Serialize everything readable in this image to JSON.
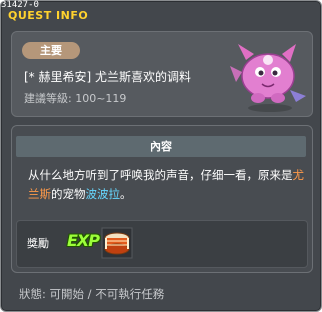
{
  "window": {
    "id": "31427-0",
    "title": "QUEST INFO"
  },
  "quest": {
    "badge": "主要",
    "name": "[* 赫里希安] 尤兰斯喜欢的调料",
    "level": "建議等級: 100~119"
  },
  "content": {
    "header": "內容",
    "desc_part1": "从什么地方听到了呼唤我的声音，仔细一看，原来是",
    "desc_name1": "尤兰斯",
    "desc_part2": "的宠物",
    "desc_name2": "波波拉",
    "desc_part3": "。"
  },
  "reward": {
    "label": "獎勵",
    "exp_text": "EXP",
    "item_icon": "bread-drum-item-icon"
  },
  "status": {
    "text": "狀態: 可開始  / 不可執行任務"
  },
  "colors": {
    "title": "#ffd22e",
    "badge_bg": "#b5977a",
    "highlight_orange": "#ff9a4a",
    "highlight_cyan": "#66d8ff",
    "window_bg": "#43474c"
  }
}
